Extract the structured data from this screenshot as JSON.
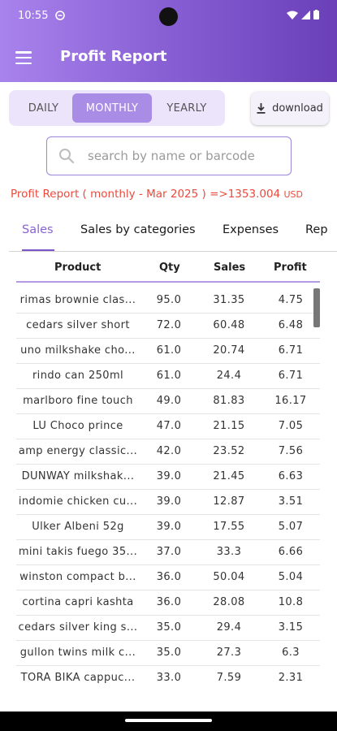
{
  "status_bar": {
    "time": "10:55"
  },
  "app_bar": {
    "title": "Profit Report"
  },
  "period_selector": {
    "options": [
      {
        "label": "DAILY",
        "active": false
      },
      {
        "label": "MONTHLY",
        "active": true
      },
      {
        "label": "YEARLY",
        "active": false
      }
    ]
  },
  "download_button": {
    "label": "download",
    "icon": "download-icon"
  },
  "search": {
    "placeholder": "search by name or barcode",
    "value": ""
  },
  "report_summary": {
    "text": "Profit Report ( monthly - Mar 2025 ) =>",
    "total": "1353.004",
    "currency": "USD",
    "color": "#ec4a3c"
  },
  "tabs": [
    {
      "label": "Sales",
      "active": true
    },
    {
      "label": "Sales by categories",
      "active": false
    },
    {
      "label": "Expenses",
      "active": false
    },
    {
      "label": "Rep",
      "active": false
    }
  ],
  "table": {
    "headers": {
      "product": "Product",
      "qty": "Qty",
      "sales": "Sales",
      "profit": "Profit"
    },
    "rows": [
      {
        "product": "rimas brownie clas...",
        "qty": "95.0",
        "sales": "31.35",
        "profit": "4.75"
      },
      {
        "product": "cedars silver short",
        "qty": "72.0",
        "sales": "60.48",
        "profit": "6.48"
      },
      {
        "product": "uno milkshake cho...",
        "qty": "61.0",
        "sales": "20.74",
        "profit": "6.71"
      },
      {
        "product": "rindo can 250ml",
        "qty": "61.0",
        "sales": "24.4",
        "profit": "6.71"
      },
      {
        "product": "marlboro fine touch",
        "qty": "49.0",
        "sales": "81.83",
        "profit": "16.17"
      },
      {
        "product": "LU Choco prince",
        "qty": "47.0",
        "sales": "21.15",
        "profit": "7.05"
      },
      {
        "product": "amp energy classic...",
        "qty": "42.0",
        "sales": "23.52",
        "profit": "7.56"
      },
      {
        "product": "DUNWAY milkshak...",
        "qty": "39.0",
        "sales": "21.45",
        "profit": "6.63"
      },
      {
        "product": "indomie chicken cu...",
        "qty": "39.0",
        "sales": "12.87",
        "profit": "3.51"
      },
      {
        "product": "Ulker Albeni 52g",
        "qty": "39.0",
        "sales": "17.55",
        "profit": "5.07"
      },
      {
        "product": "mini takis fuego 35...",
        "qty": "37.0",
        "sales": "33.3",
        "profit": "6.66"
      },
      {
        "product": "winston compact b...",
        "qty": "36.0",
        "sales": "50.04",
        "profit": "5.04"
      },
      {
        "product": "cortina capri kashta",
        "qty": "36.0",
        "sales": "28.08",
        "profit": "10.8"
      },
      {
        "product": "cedars silver king s...",
        "qty": "35.0",
        "sales": "29.4",
        "profit": "3.15"
      },
      {
        "product": "gullon twins milk c...",
        "qty": "35.0",
        "sales": "27.3",
        "profit": "6.3"
      },
      {
        "product": "TORA BIKA cappuc...",
        "qty": "33.0",
        "sales": "7.59",
        "profit": "2.31"
      }
    ]
  },
  "colors": {
    "accent": "#8a63d2",
    "app_bar_start": "#a983ec",
    "app_bar_end": "#6a3fb8"
  }
}
